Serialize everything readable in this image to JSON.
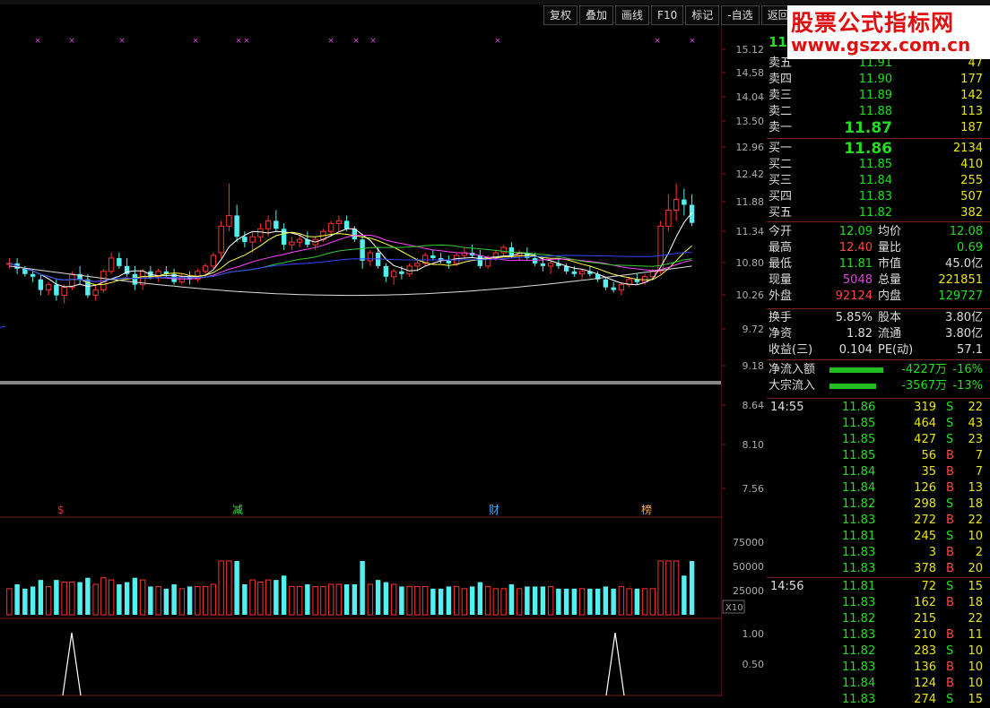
{
  "toolbar": {
    "buttons": [
      "复权",
      "叠加",
      "画线",
      "F10",
      "标记",
      "-自选",
      "返回"
    ]
  },
  "price_axis": [
    "15.12",
    "14.58",
    "14.04",
    "13.50",
    "12.96",
    "12.42",
    "11.88",
    "11.34",
    "10.80",
    "10.26",
    "9.72",
    "9.18",
    "8.64",
    "8.10",
    "7.56"
  ],
  "volume_axis": [
    "75000",
    "50000",
    "25000"
  ],
  "volume_multiplier": "X10",
  "indicator_axis": [
    "1.00",
    "0.50"
  ],
  "event_labels": [
    {
      "text": "$",
      "color": "#e03030"
    },
    {
      "text": "减",
      "color": "#44dd44"
    },
    {
      "text": "财",
      "color": "#44aaff"
    },
    {
      "text": "榜",
      "color": "#ffaa44"
    }
  ],
  "quote": {
    "current_price_partial": "11",
    "sell": [
      {
        "label": "卖五",
        "price": "11.91",
        "vol": "47"
      },
      {
        "label": "卖四",
        "price": "11.90",
        "vol": "177"
      },
      {
        "label": "卖三",
        "price": "11.89",
        "vol": "142"
      },
      {
        "label": "卖二",
        "price": "11.88",
        "vol": "113"
      },
      {
        "label": "卖一",
        "price": "11.87",
        "vol": "187"
      }
    ],
    "buy": [
      {
        "label": "买一",
        "price": "11.86",
        "vol": "2134"
      },
      {
        "label": "买二",
        "price": "11.85",
        "vol": "410"
      },
      {
        "label": "买三",
        "price": "11.84",
        "vol": "255"
      },
      {
        "label": "买四",
        "price": "11.83",
        "vol": "507"
      },
      {
        "label": "买五",
        "price": "11.82",
        "vol": "382"
      }
    ],
    "stats1": [
      {
        "l1": "今开",
        "v1": "12.09",
        "c1": "#22dd22",
        "l2": "均价",
        "v2": "12.08",
        "c2": "#22dd22"
      },
      {
        "l1": "最高",
        "v1": "12.40",
        "c1": "#ff4444",
        "l2": "量比",
        "v2": "0.69",
        "c2": "#22dd22"
      },
      {
        "l1": "最低",
        "v1": "11.81",
        "c1": "#22dd22",
        "l2": "市值",
        "v2": "45.0亿",
        "c2": "#dddddd"
      },
      {
        "l1": "现量",
        "v1": "5048",
        "c1": "#dd44dd",
        "l2": "总量",
        "v2": "221851",
        "c2": "#e8e800"
      },
      {
        "l1": "外盘",
        "v1": "92124",
        "c1": "#ff4444",
        "l2": "内盘",
        "v2": "129727",
        "c2": "#22dd22"
      }
    ],
    "stats2": [
      {
        "l1": "换手",
        "v1": "5.85%",
        "c1": "#dddddd",
        "l2": "股本",
        "v2": "3.80亿",
        "c2": "#dddddd"
      },
      {
        "l1": "净资",
        "v1": "1.82",
        "c1": "#dddddd",
        "l2": "流通",
        "v2": "3.80亿",
        "c2": "#dddddd"
      },
      {
        "l1": "收益(三)",
        "v1": "0.104",
        "c1": "#dddddd",
        "l2": "PE(动)",
        "v2": "57.1",
        "c2": "#dddddd"
      }
    ],
    "flows": [
      {
        "label": "净流入额",
        "value": "-4227万",
        "pct": "-16%"
      },
      {
        "label": "大宗流入",
        "value": "-3567万",
        "pct": "-13%"
      }
    ]
  },
  "ticks": [
    {
      "time": "14:55",
      "price": "11.86",
      "vol": "319",
      "bs": "S",
      "n": "22"
    },
    {
      "time": "",
      "price": "11.85",
      "vol": "464",
      "bs": "S",
      "n": "43"
    },
    {
      "time": "",
      "price": "11.85",
      "vol": "427",
      "bs": "S",
      "n": "23"
    },
    {
      "time": "",
      "price": "11.85",
      "vol": "56",
      "bs": "B",
      "n": "7"
    },
    {
      "time": "",
      "price": "11.84",
      "vol": "35",
      "bs": "B",
      "n": "7"
    },
    {
      "time": "",
      "price": "11.84",
      "vol": "126",
      "bs": "B",
      "n": "13"
    },
    {
      "time": "",
      "price": "11.82",
      "vol": "298",
      "bs": "S",
      "n": "18"
    },
    {
      "time": "",
      "price": "11.83",
      "vol": "272",
      "bs": "B",
      "n": "22"
    },
    {
      "time": "",
      "price": "11.81",
      "vol": "245",
      "bs": "S",
      "n": "10"
    },
    {
      "time": "",
      "price": "11.83",
      "vol": "3",
      "bs": "B",
      "n": "2"
    },
    {
      "time": "",
      "price": "11.83",
      "vol": "378",
      "bs": "B",
      "n": "20"
    },
    {
      "time": "14:56",
      "price": "11.81",
      "vol": "72",
      "bs": "S",
      "n": "15"
    },
    {
      "time": "",
      "price": "11.83",
      "vol": "162",
      "bs": "B",
      "n": "18"
    },
    {
      "time": "",
      "price": "11.82",
      "vol": "215",
      "bs": "",
      "n": "22"
    },
    {
      "time": "",
      "price": "11.83",
      "vol": "210",
      "bs": "B",
      "n": "11"
    },
    {
      "time": "",
      "price": "11.82",
      "vol": "283",
      "bs": "S",
      "n": "10"
    },
    {
      "time": "",
      "price": "11.83",
      "vol": "136",
      "bs": "B",
      "n": "10"
    },
    {
      "time": "",
      "price": "11.84",
      "vol": "124",
      "bs": "B",
      "n": "10"
    },
    {
      "time": "",
      "price": "11.83",
      "vol": "274",
      "bs": "S",
      "n": "15"
    }
  ],
  "watermark": {
    "line1": "股票公式指标网",
    "line2": "www.gszx.com.cn"
  },
  "chart_data": {
    "type": "candlestick",
    "ylim": [
      9.18,
      15.12
    ],
    "candles": [
      [
        11.1,
        11.2,
        11.0,
        11.1
      ],
      [
        11.1,
        11.2,
        10.9,
        11.0
      ],
      [
        11.0,
        11.05,
        10.85,
        10.9
      ],
      [
        10.9,
        11.0,
        10.75,
        10.85
      ],
      [
        10.8,
        10.9,
        10.5,
        10.6
      ],
      [
        10.6,
        10.75,
        10.5,
        10.7
      ],
      [
        10.7,
        10.8,
        10.4,
        10.5
      ],
      [
        10.5,
        10.7,
        10.35,
        10.65
      ],
      [
        10.65,
        10.95,
        10.6,
        10.9
      ],
      [
        10.9,
        11.05,
        10.7,
        10.8
      ],
      [
        10.8,
        10.9,
        10.45,
        10.5
      ],
      [
        10.5,
        10.7,
        10.4,
        10.6
      ],
      [
        10.6,
        11.0,
        10.55,
        10.95
      ],
      [
        10.95,
        11.3,
        10.9,
        11.2
      ],
      [
        11.2,
        11.3,
        11.0,
        11.05
      ],
      [
        11.05,
        11.2,
        10.85,
        10.9
      ],
      [
        10.9,
        11.05,
        10.6,
        10.7
      ],
      [
        10.7,
        11.0,
        10.6,
        10.95
      ],
      [
        10.95,
        11.05,
        10.8,
        10.85
      ],
      [
        10.85,
        11.0,
        10.75,
        10.95
      ],
      [
        10.95,
        11.05,
        10.85,
        10.9
      ],
      [
        10.9,
        11.0,
        10.7,
        10.75
      ],
      [
        10.75,
        10.9,
        10.7,
        10.85
      ],
      [
        10.85,
        10.95,
        10.7,
        10.8
      ],
      [
        10.8,
        11.0,
        10.75,
        10.95
      ],
      [
        10.95,
        11.1,
        10.85,
        11.05
      ],
      [
        11.05,
        11.3,
        11.0,
        11.25
      ],
      [
        11.3,
        11.9,
        11.2,
        11.8
      ],
      [
        11.8,
        12.6,
        11.7,
        12.0
      ],
      [
        12.0,
        12.2,
        11.5,
        11.6
      ],
      [
        11.6,
        11.7,
        11.4,
        11.5
      ],
      [
        11.5,
        11.7,
        11.3,
        11.6
      ],
      [
        11.6,
        11.85,
        11.5,
        11.75
      ],
      [
        11.75,
        12.0,
        11.6,
        11.9
      ],
      [
        11.9,
        12.1,
        11.7,
        11.75
      ],
      [
        11.75,
        11.85,
        11.35,
        11.45
      ],
      [
        11.45,
        11.6,
        11.35,
        11.5
      ],
      [
        11.5,
        11.65,
        11.4,
        11.55
      ],
      [
        11.55,
        11.7,
        11.4,
        11.45
      ],
      [
        11.45,
        11.6,
        11.35,
        11.55
      ],
      [
        11.55,
        11.75,
        11.5,
        11.7
      ],
      [
        11.7,
        11.9,
        11.6,
        11.85
      ],
      [
        11.85,
        12.0,
        11.7,
        11.9
      ],
      [
        11.9,
        12.0,
        11.7,
        11.75
      ],
      [
        11.75,
        11.8,
        11.5,
        11.55
      ],
      [
        11.55,
        11.65,
        11.0,
        11.15
      ],
      [
        11.15,
        11.35,
        11.05,
        11.3
      ],
      [
        11.3,
        11.4,
        11.0,
        11.05
      ],
      [
        11.05,
        11.1,
        10.75,
        10.85
      ],
      [
        10.85,
        11.0,
        10.7,
        10.95
      ],
      [
        10.95,
        11.05,
        10.8,
        10.9
      ],
      [
        10.9,
        11.1,
        10.85,
        11.05
      ],
      [
        11.05,
        11.2,
        10.95,
        11.1
      ],
      [
        11.1,
        11.3,
        11.05,
        11.25
      ],
      [
        11.25,
        11.35,
        11.15,
        11.2
      ],
      [
        11.2,
        11.3,
        11.1,
        11.15
      ],
      [
        11.15,
        11.25,
        11.0,
        11.1
      ],
      [
        11.1,
        11.3,
        11.05,
        11.25
      ],
      [
        11.25,
        11.4,
        11.2,
        11.3
      ],
      [
        11.3,
        11.45,
        11.2,
        11.25
      ],
      [
        11.25,
        11.35,
        11.0,
        11.05
      ],
      [
        11.05,
        11.25,
        11.0,
        11.2
      ],
      [
        11.2,
        11.35,
        11.15,
        11.3
      ],
      [
        11.3,
        11.45,
        11.25,
        11.4
      ],
      [
        11.4,
        11.5,
        11.2,
        11.25
      ],
      [
        11.25,
        11.35,
        11.15,
        11.3
      ],
      [
        11.3,
        11.4,
        11.15,
        11.2
      ],
      [
        11.2,
        11.3,
        11.05,
        11.1
      ],
      [
        11.1,
        11.2,
        10.95,
        11.05
      ],
      [
        11.05,
        11.15,
        10.9,
        11.1
      ],
      [
        11.1,
        11.2,
        11.0,
        11.05
      ],
      [
        11.05,
        11.1,
        10.9,
        10.95
      ],
      [
        10.95,
        11.05,
        10.85,
        10.9
      ],
      [
        10.9,
        11.0,
        10.8,
        10.95
      ],
      [
        10.95,
        11.05,
        10.85,
        10.9
      ],
      [
        10.9,
        10.95,
        10.75,
        10.8
      ],
      [
        10.8,
        10.85,
        10.6,
        10.65
      ],
      [
        10.65,
        10.75,
        10.55,
        10.6
      ],
      [
        10.6,
        10.75,
        10.5,
        10.7
      ],
      [
        10.7,
        10.85,
        10.65,
        10.8
      ],
      [
        10.8,
        10.9,
        10.7,
        10.75
      ],
      [
        10.75,
        10.9,
        10.7,
        10.85
      ],
      [
        10.85,
        11.0,
        10.8,
        10.95
      ],
      [
        10.95,
        11.9,
        10.9,
        11.8
      ],
      [
        11.8,
        12.4,
        11.7,
        12.1
      ],
      [
        12.1,
        12.6,
        11.9,
        12.3
      ],
      [
        12.3,
        12.5,
        12.0,
        12.2
      ],
      [
        12.2,
        12.4,
        11.8,
        11.86
      ]
    ]
  }
}
